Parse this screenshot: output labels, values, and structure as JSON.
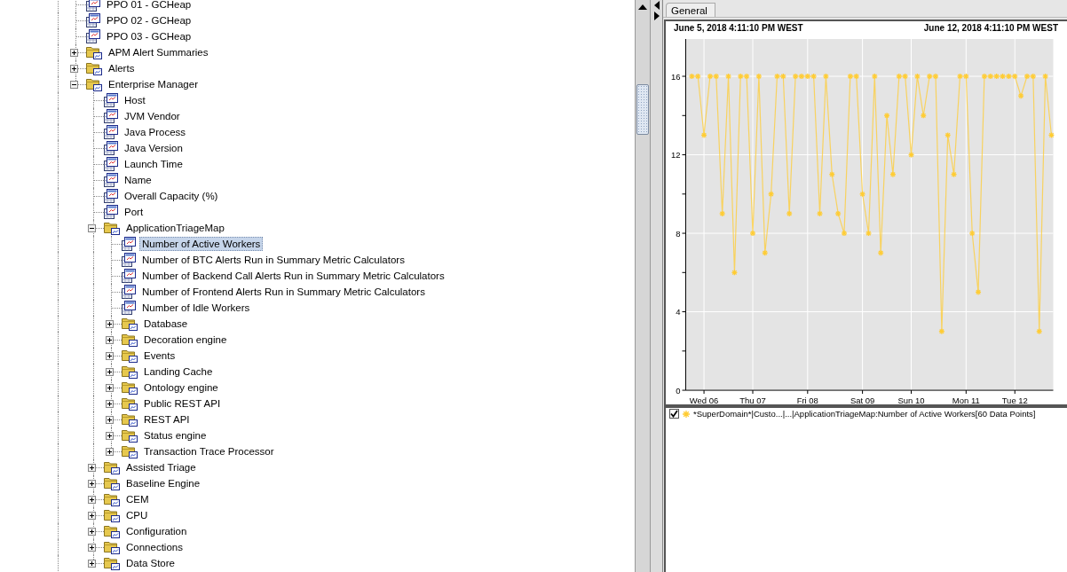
{
  "tree": [
    {
      "label": "PPO 01 - GCHeap",
      "kind": "metric",
      "selected": false
    },
    {
      "label": "PPO 02 - GCHeap",
      "kind": "metric",
      "selected": false
    },
    {
      "label": "PPO 03 - GCHeap",
      "kind": "metric",
      "selected": false
    },
    {
      "label": "APM Alert Summaries",
      "kind": "folder",
      "expanded": false,
      "selected": false
    },
    {
      "label": "Alerts",
      "kind": "folder",
      "expanded": false,
      "selected": false
    },
    {
      "label": "Enterprise Manager",
      "kind": "folder",
      "expanded": true,
      "selected": false,
      "children": [
        {
          "label": "Host",
          "kind": "metric",
          "selected": false
        },
        {
          "label": "JVM Vendor",
          "kind": "metric",
          "selected": false
        },
        {
          "label": "Java Process",
          "kind": "metric",
          "selected": false
        },
        {
          "label": "Java Version",
          "kind": "metric",
          "selected": false
        },
        {
          "label": "Launch Time",
          "kind": "metric",
          "selected": false
        },
        {
          "label": "Name",
          "kind": "metric",
          "selected": false
        },
        {
          "label": "Overall Capacity (%)",
          "kind": "metric",
          "selected": false
        },
        {
          "label": "Port",
          "kind": "metric",
          "selected": false
        },
        {
          "label": "ApplicationTriageMap",
          "kind": "folder",
          "expanded": true,
          "selected": false,
          "children": [
            {
              "label": "Number of Active Workers",
              "kind": "metric",
              "selected": true
            },
            {
              "label": "Number of BTC Alerts Run in Summary Metric Calculators",
              "kind": "metric",
              "selected": false
            },
            {
              "label": "Number of Backend Call Alerts Run in Summary Metric Calculators",
              "kind": "metric",
              "selected": false
            },
            {
              "label": "Number of Frontend Alerts Run in Summary Metric Calculators",
              "kind": "metric",
              "selected": false
            },
            {
              "label": "Number of Idle Workers",
              "kind": "metric",
              "selected": false
            },
            {
              "label": "Database",
              "kind": "folder",
              "expanded": false,
              "selected": false
            },
            {
              "label": "Decoration engine",
              "kind": "folder",
              "expanded": false,
              "selected": false
            },
            {
              "label": "Events",
              "kind": "folder",
              "expanded": false,
              "selected": false
            },
            {
              "label": "Landing Cache",
              "kind": "folder",
              "expanded": false,
              "selected": false
            },
            {
              "label": "Ontology engine",
              "kind": "folder",
              "expanded": false,
              "selected": false
            },
            {
              "label": "Public REST API",
              "kind": "folder",
              "expanded": false,
              "selected": false
            },
            {
              "label": "REST API",
              "kind": "folder",
              "expanded": false,
              "selected": false
            },
            {
              "label": "Status engine",
              "kind": "folder",
              "expanded": false,
              "selected": false
            },
            {
              "label": "Transaction Trace Processor",
              "kind": "folder",
              "expanded": false,
              "selected": false
            }
          ]
        },
        {
          "label": "Assisted Triage",
          "kind": "folder",
          "expanded": false,
          "selected": false
        },
        {
          "label": "Baseline Engine",
          "kind": "folder",
          "expanded": false,
          "selected": false
        },
        {
          "label": "CEM",
          "kind": "folder",
          "expanded": false,
          "selected": false
        },
        {
          "label": "CPU",
          "kind": "folder",
          "expanded": false,
          "selected": false
        },
        {
          "label": "Configuration",
          "kind": "folder",
          "expanded": false,
          "selected": false
        },
        {
          "label": "Connections",
          "kind": "folder",
          "expanded": false,
          "selected": false
        },
        {
          "label": "Data Store",
          "kind": "folder",
          "expanded": false,
          "selected": false
        }
      ]
    }
  ],
  "tabs": [
    {
      "label": "General",
      "selected": true
    }
  ],
  "chart": {
    "start_time": "June 5, 2018 4:11:10 PM WEST",
    "end_time": "June 12, 2018 4:11:10 PM WEST",
    "chart_data": {
      "type": "line",
      "grid": true,
      "ylim": [
        0,
        17.9
      ],
      "categories": [
        null,
        null,
        "Wed 06",
        null,
        null,
        null,
        null,
        null,
        null,
        null,
        "Thu 07",
        null,
        null,
        null,
        null,
        null,
        null,
        null,
        null,
        "Fri 08",
        null,
        null,
        null,
        null,
        null,
        null,
        null,
        null,
        "Sat 09",
        null,
        null,
        null,
        null,
        null,
        null,
        null,
        "Sun 10",
        null,
        null,
        null,
        null,
        null,
        null,
        null,
        null,
        "Mon 11",
        null,
        null,
        null,
        null,
        null,
        null,
        null,
        "Tue 12",
        null,
        null,
        null,
        null,
        null,
        null
      ],
      "yticks": [
        0,
        4,
        8,
        12,
        16
      ],
      "series": [
        {
          "name": "*SuperDomain*|Custo...|...|ApplicationTriageMap:Number of Active Workers[60 Data Points]",
          "color": "#ffcc33",
          "marker": "cross",
          "values": [
            16,
            16,
            13,
            16,
            16,
            9,
            16,
            6,
            16,
            16,
            8,
            16,
            7,
            10,
            16,
            16,
            9,
            16,
            16,
            16,
            16,
            9,
            16,
            11,
            9,
            8,
            16,
            16,
            10,
            8,
            16,
            7,
            14,
            11,
            16,
            16,
            12,
            16,
            14,
            16,
            16,
            3,
            13,
            11,
            16,
            16,
            8,
            5,
            16,
            16,
            16,
            16,
            16,
            16,
            15,
            16,
            16,
            3,
            16,
            13
          ]
        }
      ]
    }
  },
  "legend": [
    {
      "checked": true
    }
  ]
}
